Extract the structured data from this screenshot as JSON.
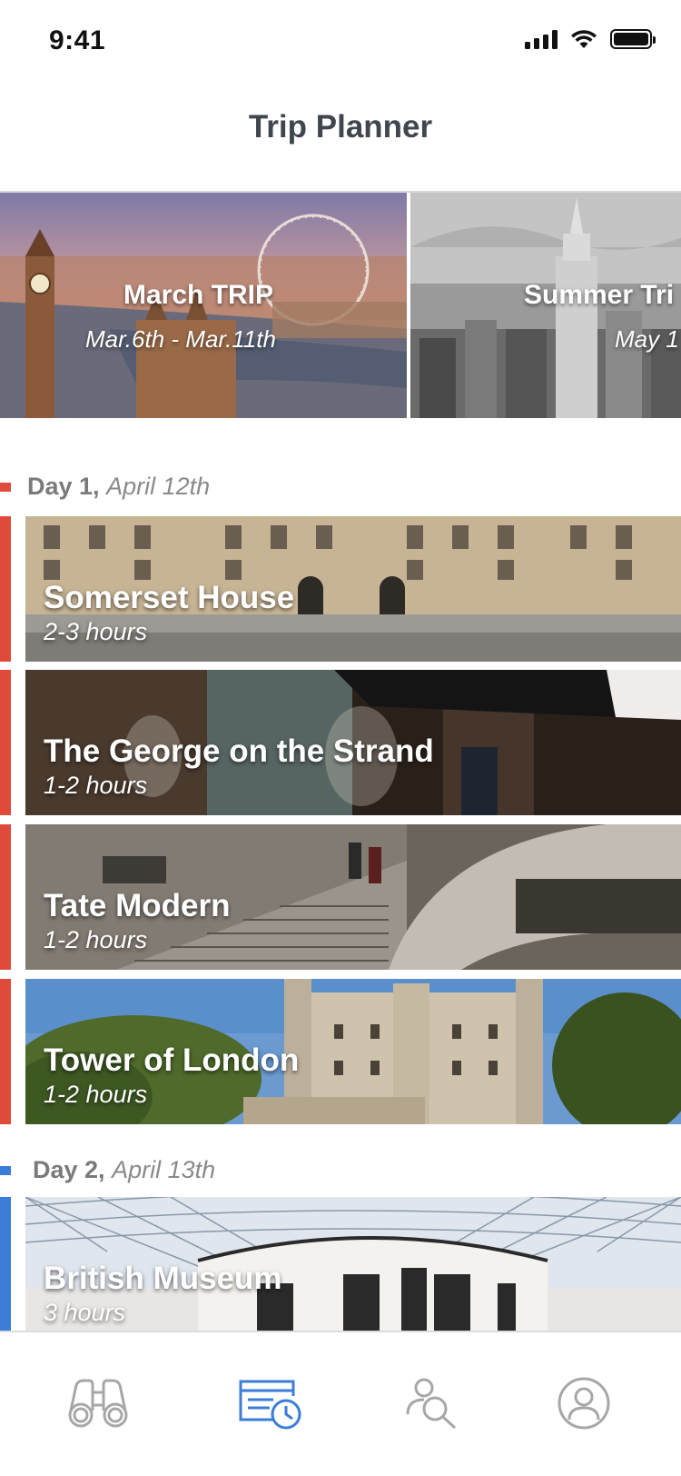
{
  "status": {
    "time": "9:41"
  },
  "nav": {
    "title": "Trip Planner"
  },
  "trips": [
    {
      "name": "March TRIP",
      "dates": "Mar.6th - Mar.11th"
    },
    {
      "name": "Summer Tri",
      "dates": "May 1"
    }
  ],
  "days": [
    {
      "label": "Day 1,",
      "date": "April 12th",
      "color": "#e04a3a",
      "places": [
        {
          "name": "Somerset House",
          "duration": "2-3 hours"
        },
        {
          "name": "The George on the Strand",
          "duration": "1-2 hours"
        },
        {
          "name": "Tate Modern",
          "duration": "1-2 hours"
        },
        {
          "name": "Tower of London",
          "duration": "1-2 hours"
        }
      ]
    },
    {
      "label": "Day 2,",
      "date": "April 13th",
      "color": "#3b7dd8",
      "places": [
        {
          "name": "British Museum",
          "duration": "3 hours"
        }
      ]
    }
  ],
  "tabs": [
    {
      "icon": "binoculars-icon",
      "active": false
    },
    {
      "icon": "calendar-clock-icon",
      "active": true
    },
    {
      "icon": "search-people-icon",
      "active": false
    },
    {
      "icon": "profile-icon",
      "active": false
    }
  ],
  "colors": {
    "accent": "#3b7dd8",
    "inactive_icon": "#a7a7a7",
    "title": "#40464f"
  }
}
